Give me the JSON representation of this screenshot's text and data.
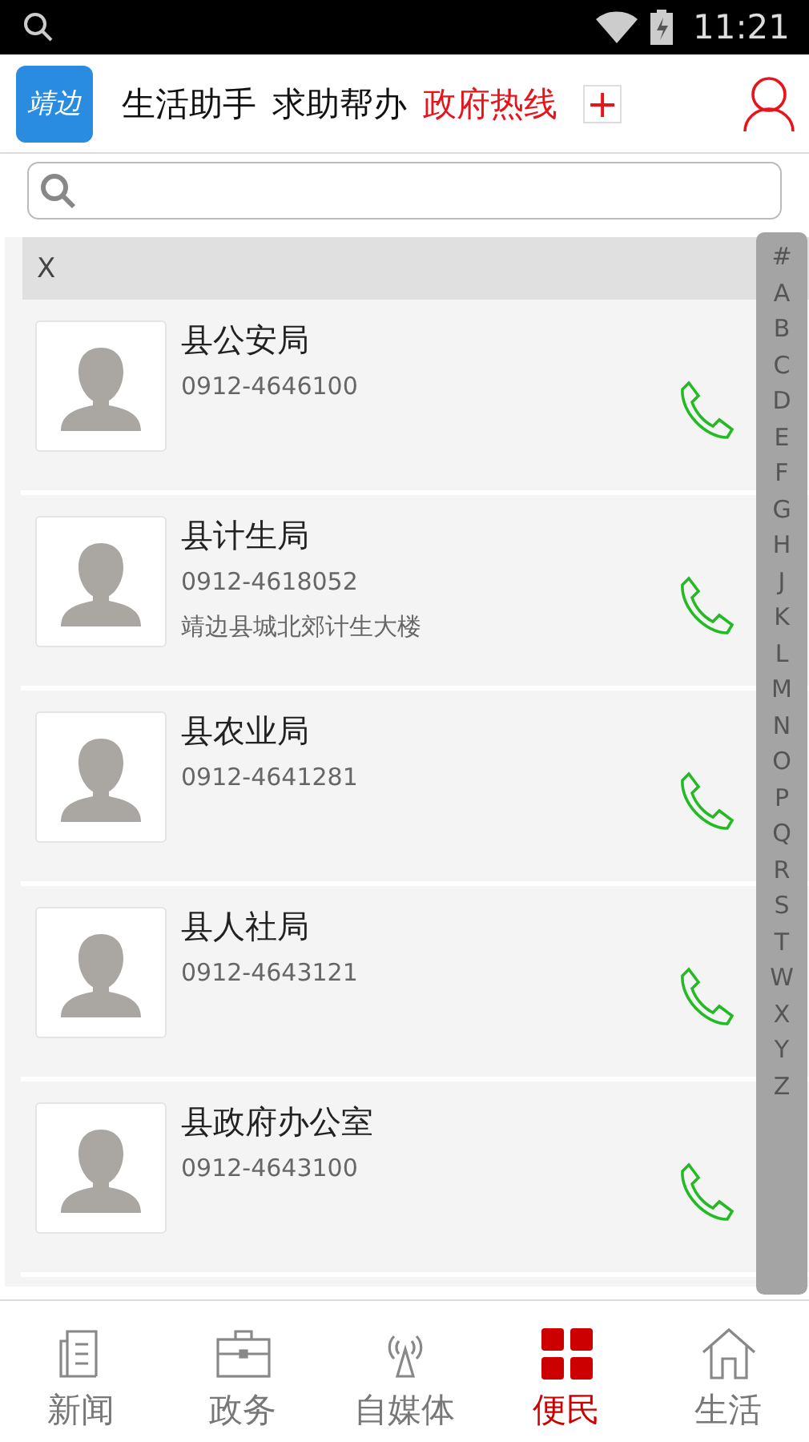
{
  "status_bar": {
    "time": "11:21"
  },
  "header": {
    "logo_text": "靖边",
    "tabs": [
      {
        "label": "生活助手",
        "selected": false
      },
      {
        "label": "求助帮办",
        "selected": false
      },
      {
        "label": "政府热线",
        "selected": true
      }
    ],
    "add_label": "+"
  },
  "section": {
    "letter": "X"
  },
  "contacts": [
    {
      "name": "县公安局",
      "phone": "0912-4646100"
    },
    {
      "name": "县计生局",
      "phone": "0912-4618052",
      "address": "靖边县城北郊计生大楼"
    },
    {
      "name": "县农业局",
      "phone": "0912-4641281"
    },
    {
      "name": "县人社局",
      "phone": "0912-4643121"
    },
    {
      "name": "县政府办公室",
      "phone": "0912-4643100"
    }
  ],
  "index": [
    "#",
    "A",
    "B",
    "C",
    "D",
    "E",
    "F",
    "G",
    "H",
    "J",
    "K",
    "L",
    "M",
    "N",
    "O",
    "P",
    "Q",
    "R",
    "S",
    "T",
    "W",
    "X",
    "Y",
    "Z"
  ],
  "bottom_nav": [
    {
      "label": "新闻",
      "kind": "news",
      "selected": false
    },
    {
      "label": "政务",
      "kind": "briefcase",
      "selected": false
    },
    {
      "label": "自媒体",
      "kind": "antenna",
      "selected": false
    },
    {
      "label": "便民",
      "kind": "grid",
      "selected": true
    },
    {
      "label": "生活",
      "kind": "home",
      "selected": false
    }
  ]
}
